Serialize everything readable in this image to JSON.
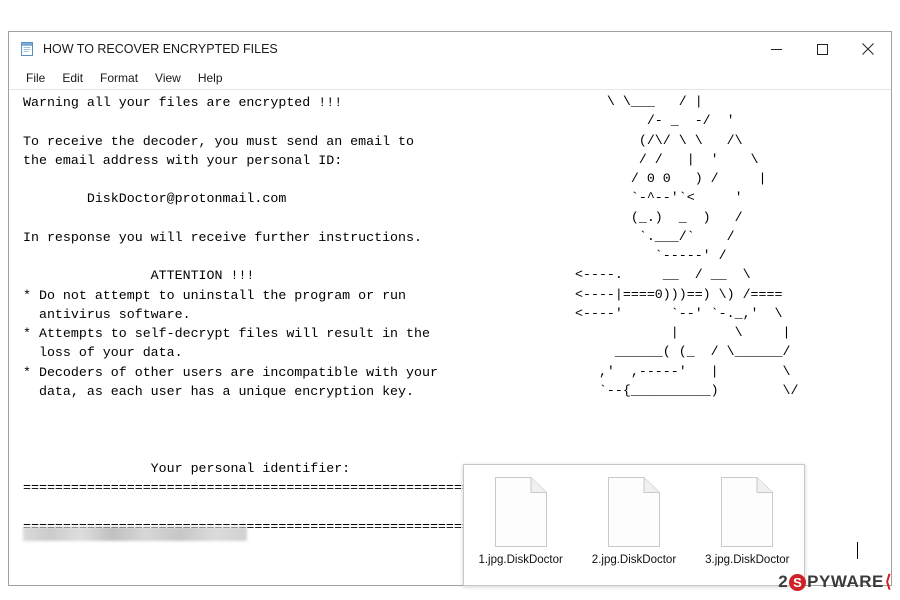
{
  "window": {
    "title": "HOW TO RECOVER ENCRYPTED FILES",
    "icon": "notepad-icon",
    "controls": {
      "minimize": "minimize-icon",
      "maximize": "maximize-icon",
      "close": "close-icon"
    }
  },
  "menu": {
    "items": [
      {
        "label": "File"
      },
      {
        "label": "Edit"
      },
      {
        "label": "Format"
      },
      {
        "label": "View"
      },
      {
        "label": "Help"
      }
    ]
  },
  "note": {
    "body": "Warning all your files are encrypted !!!\n\nTo receive the decoder, you must send an email to\nthe email address with your personal ID:\n\n        DiskDoctor@protonmail.com\n\nIn response you will receive further instructions.\n\n                ATTENTION !!!\n* Do not attempt to uninstall the program or run\n  antivirus software.\n* Attempts to self-decrypt files will result in the\n  loss of your data.\n* Decoders of other users are incompatible with your\n  data, as each user has a unique encryption key.\n\n\n\n                Your personal identifier:\n==========================================================================\n\n==========================================================================",
    "ascii_art": "    \\ \\___   / |\n         /- _  -/  '\n        (/\\/ \\ \\   /\\\n        / /   |  '    \\\n       / 0 0   ) /     |\n       `-^--'`<     '\n       (_.)  _  )   /\n        `.___/`    /\n          `-----' /\n<----.     __  / __  \\\n<----|====0)))==) \\) /====\n<----'      `--' `-._,'  \\\n            |       \\     |\n     ______( (_  / \\______/\n   ,'  ,-----'   |        \\\n   `--{__________)        \\/",
    "email": "DiskDoctor@protonmail.com",
    "personal_id_label": "Your personal identifier:",
    "personal_id_value_redacted": true
  },
  "thumbnails": {
    "files": [
      {
        "label": "1.jpg.DiskDoctor",
        "icon": "blank-file-icon"
      },
      {
        "label": "2.jpg.DiskDoctor",
        "icon": "blank-file-icon"
      },
      {
        "label": "3.jpg.DiskDoctor",
        "icon": "blank-file-icon"
      }
    ]
  },
  "watermark": {
    "prefix": "2",
    "badge": "S",
    "suffix": "PYWARE",
    "arrow": "⟨"
  },
  "colors": {
    "accent_red": "#cf2127",
    "window_border": "#a0a0a0",
    "text": "#000000"
  }
}
